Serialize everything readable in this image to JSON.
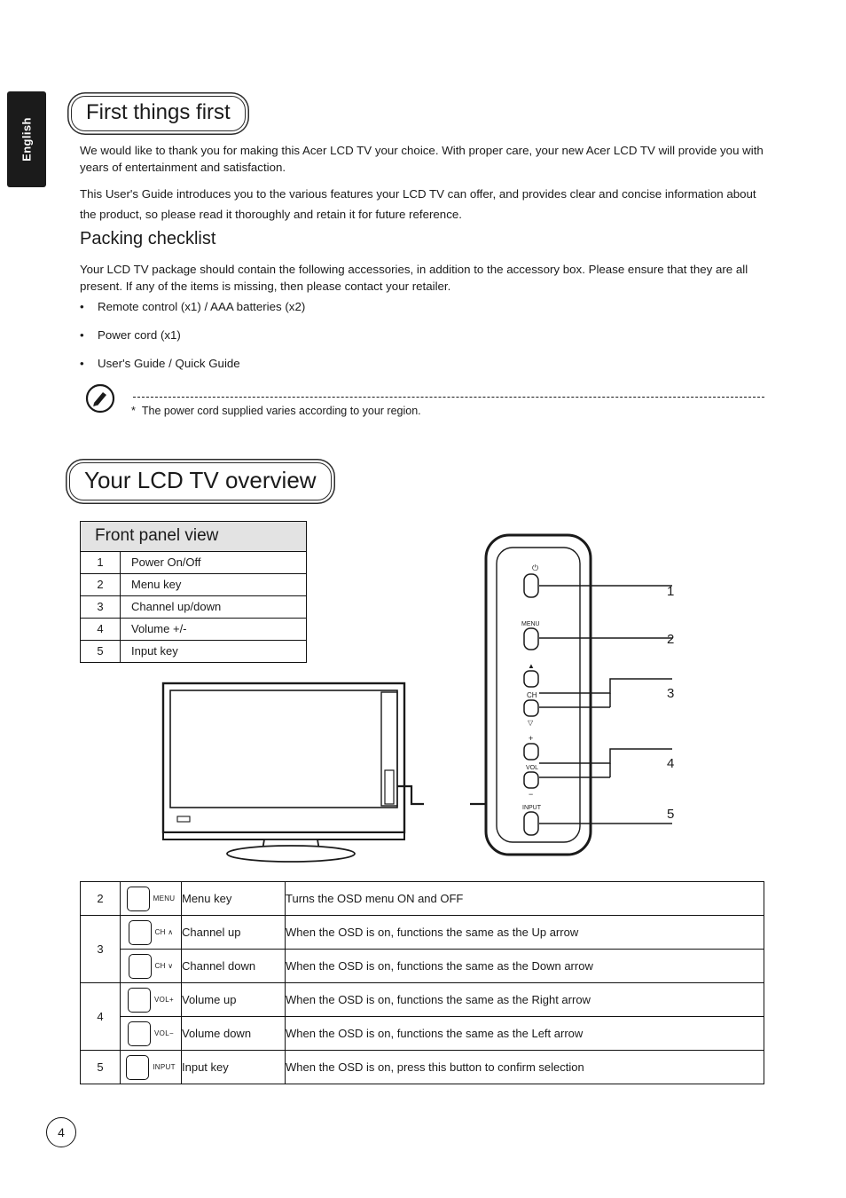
{
  "side_tab": {
    "label": "English"
  },
  "sections": {
    "first_things_first": "First things first",
    "overview": "Your LCD TV overview"
  },
  "paragraphs": {
    "p1": "We would like to thank you for making this Acer LCD TV your choice. With proper care, your new Acer LCD TV will provide you with years of entertainment and satisfaction.",
    "p2": "This User's Guide introduces you to the various features your LCD TV can offer, and provides clear and concise information about the product, so please read it thoroughly and retain it for future reference.",
    "p3": "Your LCD TV package should contain the following accessories, in addition to the accessory box. Please ensure that they are all present. If any of the items is missing, then please contact your retailer."
  },
  "packing": {
    "heading": "Packing checklist",
    "items": [
      "Remote control (x1) / AAA batteries (x2)",
      "Power cord (x1)",
      "User's Guide / Quick Guide"
    ]
  },
  "note": {
    "marker": "*",
    "text": "The power cord supplied varies according to your region."
  },
  "front_panel": {
    "title": "Front panel view",
    "rows": [
      {
        "num": "1",
        "label": "Power On/Off"
      },
      {
        "num": "2",
        "label": "Menu key"
      },
      {
        "num": "3",
        "label": "Channel up/down"
      },
      {
        "num": "4",
        "label": "Volume +/-"
      },
      {
        "num": "5",
        "label": "Input key"
      }
    ]
  },
  "callouts": [
    "1",
    "2",
    "3",
    "4",
    "5"
  ],
  "panel_buttons": {
    "power": "⏻",
    "menu": "MENU",
    "ch_up": "▲",
    "ch_label": "CH",
    "ch_down": "▽",
    "vol_plus": "+",
    "vol_label": "VOL",
    "vol_minus": "−",
    "input": "INPUT"
  },
  "detail_table": {
    "rows": [
      {
        "num": "2",
        "key": "MENU",
        "name": "Menu key",
        "desc": "Turns the OSD menu ON and OFF"
      },
      {
        "num": "3",
        "key": "CH ∧",
        "name": "Channel up",
        "desc": "When the OSD is on, functions the same as the Up arrow"
      },
      {
        "num": "",
        "key": "CH ∨",
        "name": "Channel down",
        "desc": "When the OSD is on, functions the same as the Down arrow"
      },
      {
        "num": "4",
        "key": "VOL+",
        "name": "Volume up",
        "desc": "When the OSD is on, functions the same as the Right arrow"
      },
      {
        "num": "",
        "key": "VOL−",
        "name": "Volume down",
        "desc": "When the OSD is on, functions the same as the Left arrow"
      },
      {
        "num": "5",
        "key": "INPUT",
        "name": "Input key",
        "desc": "When the OSD is on, press this button to confirm selection"
      }
    ]
  },
  "page": {
    "number": "4"
  }
}
